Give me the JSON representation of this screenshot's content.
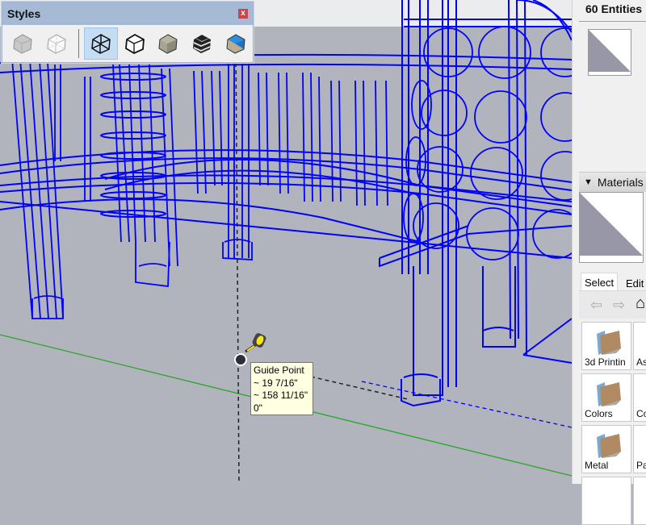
{
  "styles_panel": {
    "title": "Styles",
    "close_label": "x",
    "buttons": [
      {
        "name": "xray",
        "icon": "xray-cube-icon"
      },
      {
        "name": "back-edges",
        "icon": "back-edges-cube-icon"
      },
      {
        "name": "wireframe",
        "icon": "wireframe-cube-icon",
        "active": true
      },
      {
        "name": "hidden-line",
        "icon": "hidden-line-cube-icon"
      },
      {
        "name": "shaded",
        "icon": "shaded-cube-icon"
      },
      {
        "name": "shaded-with-textures",
        "icon": "textured-cube-icon"
      },
      {
        "name": "monochrome",
        "icon": "monochrome-cube-icon"
      }
    ]
  },
  "viewport": {
    "sky_color": "#eaecee",
    "ground_color": "#b1b4bc",
    "edge_color": "#0000ff",
    "green_axis_color": "#2aa52a",
    "tooltip": {
      "title": "Guide Point",
      "line1": "~ 19 7/16\"",
      "line2": "~ 158 11/16\"",
      "line3": "0\""
    }
  },
  "tray": {
    "entity_info": {
      "title": "60 Entities"
    },
    "materials": {
      "header": "Materials",
      "collapse_glyph": "▼",
      "tabs": {
        "select": "Select",
        "edit": "Edit"
      },
      "nav": {
        "back": "⇦",
        "forward": "⇨",
        "home": "⌂"
      },
      "categories": [
        {
          "label": "3d Printin"
        },
        {
          "label": "As"
        },
        {
          "label": "Colors"
        },
        {
          "label": "Co"
        },
        {
          "label": "Metal"
        },
        {
          "label": "Pa"
        }
      ]
    }
  }
}
